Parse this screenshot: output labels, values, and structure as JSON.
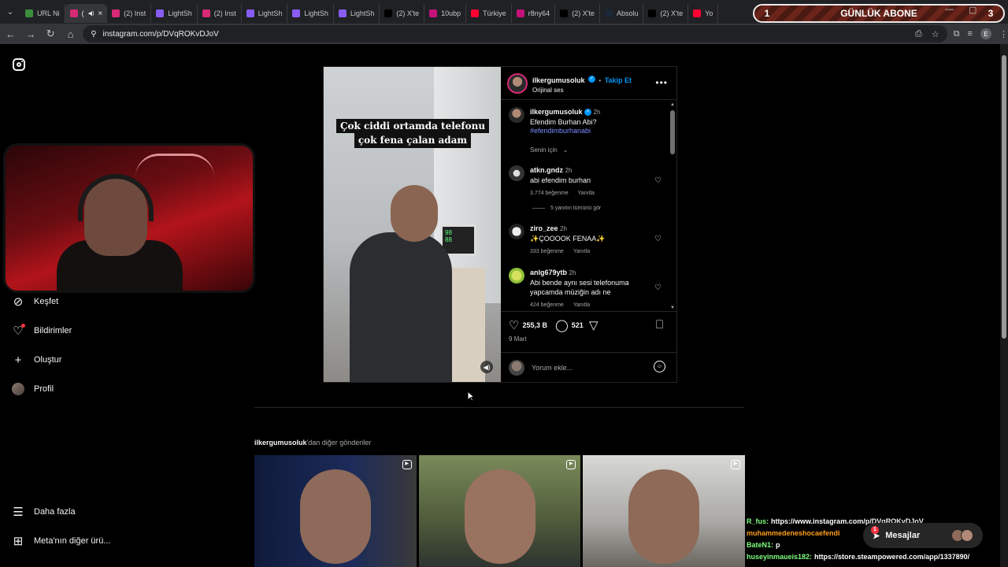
{
  "tabs": [
    {
      "label": "URL Ni",
      "favicon_color": "#3c8d3c",
      "active": false
    },
    {
      "label": "(",
      "favicon_color": "#d62976",
      "active": true
    },
    {
      "label": "(2) Inst",
      "favicon_color": "#d62976",
      "active": false
    },
    {
      "label": "LightSh",
      "favicon_color": "#8a5cf6",
      "active": false
    },
    {
      "label": "(2) Inst",
      "favicon_color": "#d62976",
      "active": false
    },
    {
      "label": "LightSh",
      "favicon_color": "#8a5cf6",
      "active": false
    },
    {
      "label": "LightSh",
      "favicon_color": "#8a5cf6",
      "active": false
    },
    {
      "label": "LightSh",
      "favicon_color": "#8a5cf6",
      "active": false
    },
    {
      "label": "(2) X'te",
      "favicon_color": "#000000",
      "active": false
    },
    {
      "label": "10ubp",
      "favicon_color": "#c4127a",
      "active": false
    },
    {
      "label": "Türkiye",
      "favicon_color": "#ff0033",
      "active": false
    },
    {
      "label": "r8ny64",
      "favicon_color": "#c4127a",
      "active": false
    },
    {
      "label": "(2) X'te",
      "favicon_color": "#000000",
      "active": false
    },
    {
      "label": "Absolu",
      "favicon_color": "#1b2838",
      "active": false
    },
    {
      "label": "(2) X'te",
      "favicon_color": "#000000",
      "active": false
    },
    {
      "label": "Yo",
      "favicon_color": "#ff0033",
      "active": false
    }
  ],
  "banner": {
    "left_num": "1",
    "title": "GÜNLÜK ABONE",
    "right_num": "3"
  },
  "address": {
    "url": "instagram.com/p/DVqROKvDJoV"
  },
  "sidebar": {
    "items": [
      {
        "label": "Keşfet",
        "icon": "compass-icon"
      },
      {
        "label": "Bildirimler",
        "icon": "heart-icon"
      },
      {
        "label": "Oluştur",
        "icon": "plus-icon"
      },
      {
        "label": "Profil",
        "icon": "avatar"
      },
      {
        "label": "Daha fazla",
        "icon": "menu-icon"
      },
      {
        "label": "Meta'nın diğer ürü...",
        "icon": "meta-apps-icon"
      }
    ]
  },
  "post": {
    "caption_lines": [
      "Çok ciddi ortamda telefonu",
      "çok fena çalan adam"
    ],
    "monitor_values": [
      "98",
      "88"
    ],
    "author": "ilkergumusoluk",
    "follow_label": "Takip Et",
    "audio": "Orijinal ses",
    "bullet": "•",
    "caption_author": "ilkergumusoluk",
    "caption_time": "2h",
    "caption_text": "Efendim Burhan Abi?",
    "caption_hashtag": "#efendimburhanabi",
    "for_you": "Senin için",
    "comments": [
      {
        "user": "atkn.gndz",
        "time": "2h",
        "text": "abi efendim burhan",
        "likes": "3.774 beğenme",
        "reply": "Yanıtla"
      },
      {
        "user": "ziro_zee",
        "time": "2h",
        "text": "✨ÇOOOOK FENAA✨",
        "likes": "333 beğenme",
        "reply": "Yanıtla"
      },
      {
        "user": "anlg679ytb",
        "time": "2h",
        "text": "Abi bende aynı sesi telefonuma yapcamda müziğin adı ne",
        "likes": "424 beğenme",
        "reply": "Yanıtla"
      }
    ],
    "view_replies": "5 yanıtın tümünü gör",
    "like_count": "255,3 B",
    "comment_count": "521",
    "date": "9 Mart",
    "comment_placeholder": "Yorum ekle..."
  },
  "more_posts": {
    "user": "ilkergumusoluk",
    "suffix": "'dan diğer gönderiler"
  },
  "chat": [
    {
      "user": "R_fus:",
      "user_color": "#7fff7f",
      "text": "https://www.instagram.com/p/DVqROKvDJoV"
    },
    {
      "user": "muhammedeneshocaefendi",
      "user_color": "#ff9f1c",
      "text": ""
    },
    {
      "user": "BateN1:",
      "user_color": "#7fff7f",
      "text": "p"
    },
    {
      "user": "huseyinmaueis182:",
      "user_color": "#7fff7f",
      "text": "https://store.steampowered.com/app/1337890/"
    }
  ],
  "messages": {
    "label": "Mesajlar",
    "badge": "1"
  }
}
